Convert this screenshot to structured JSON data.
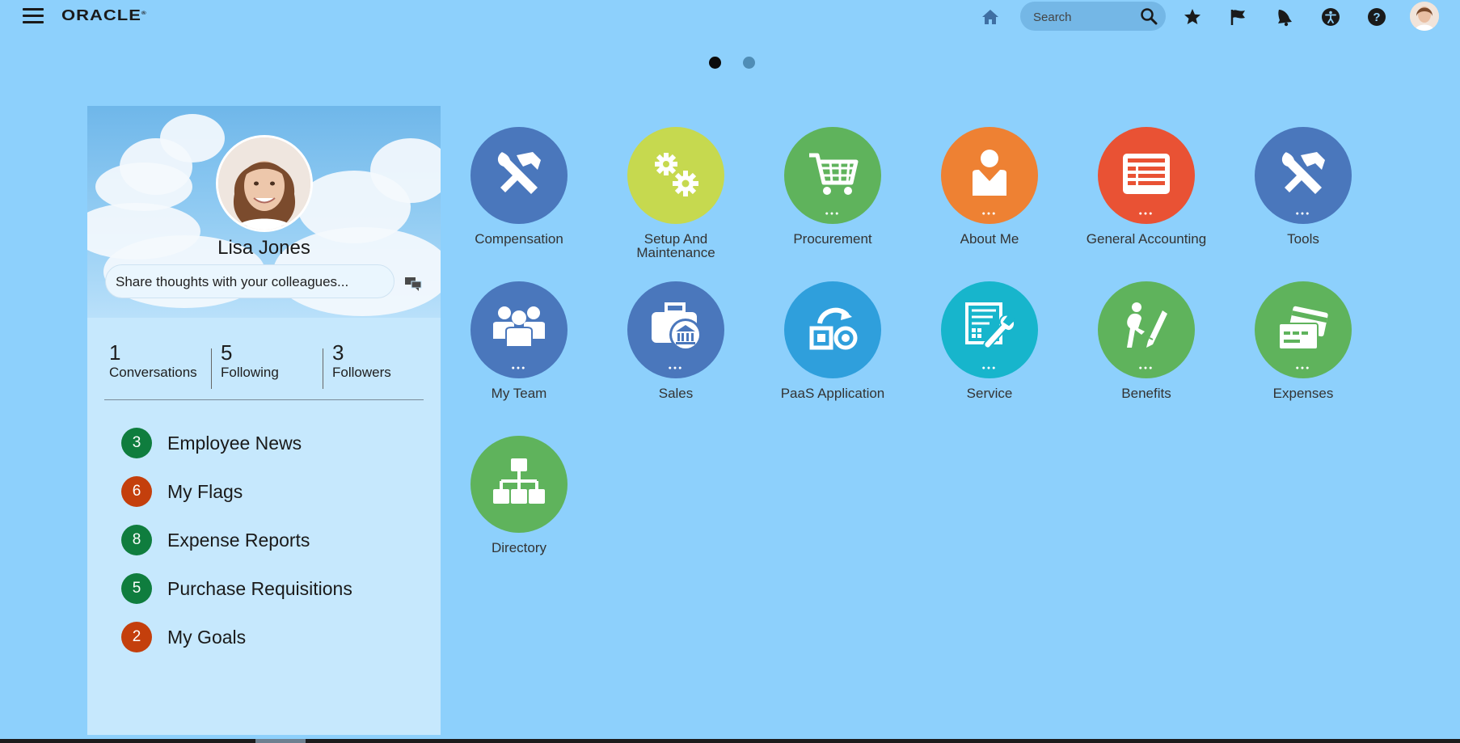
{
  "header": {
    "logo": "ORACLE",
    "search_placeholder": "Search"
  },
  "carousel": {
    "pages": 2,
    "active": 1
  },
  "profile": {
    "name": "Lisa Jones",
    "share_placeholder": "Share thoughts with your colleagues...",
    "stats": [
      {
        "count": "1",
        "label": "Conversations"
      },
      {
        "count": "5",
        "label": "Following"
      },
      {
        "count": "3",
        "label": "Followers"
      }
    ],
    "items": [
      {
        "count": "3",
        "label": "Employee News",
        "color": "#0f7d3e"
      },
      {
        "count": "6",
        "label": "My Flags",
        "color": "#c43f0c"
      },
      {
        "count": "8",
        "label": "Expense Reports",
        "color": "#0f7d3e"
      },
      {
        "count": "5",
        "label": "Purchase Requisitions",
        "color": "#0f7d3e"
      },
      {
        "count": "2",
        "label": "My Goals",
        "color": "#c43f0c"
      }
    ]
  },
  "tiles": [
    {
      "label": "Compensation",
      "color": "#4a77bc",
      "icon": "tools-icon",
      "more": false
    },
    {
      "label": "Setup And Maintenance",
      "color": "#c6d94f",
      "icon": "gears-icon",
      "more": false
    },
    {
      "label": "Procurement",
      "color": "#5fb35c",
      "icon": "cart-icon",
      "more": true
    },
    {
      "label": "About Me",
      "color": "#ee8133",
      "icon": "person-icon",
      "more": true
    },
    {
      "label": "General Accounting",
      "color": "#e95234",
      "icon": "ledger-icon",
      "more": true
    },
    {
      "label": "Tools",
      "color": "#4a77bc",
      "icon": "tools-icon",
      "more": true
    },
    {
      "label": "My Team",
      "color": "#4a77bc",
      "icon": "team-icon",
      "more": true
    },
    {
      "label": "Sales",
      "color": "#4a77bc",
      "icon": "briefcase-bank-icon",
      "more": true
    },
    {
      "label": "PaaS Application",
      "color": "#2f9fdc",
      "icon": "paas-icon",
      "more": false
    },
    {
      "label": "Service",
      "color": "#17b5cc",
      "icon": "service-icon",
      "more": true
    },
    {
      "label": "Benefits",
      "color": "#5fb35c",
      "icon": "benefits-icon",
      "more": true
    },
    {
      "label": "Expenses",
      "color": "#5fb35c",
      "icon": "cards-icon",
      "more": true
    },
    {
      "label": "Directory",
      "color": "#5fb35c",
      "icon": "org-chart-icon",
      "more": false
    }
  ]
}
